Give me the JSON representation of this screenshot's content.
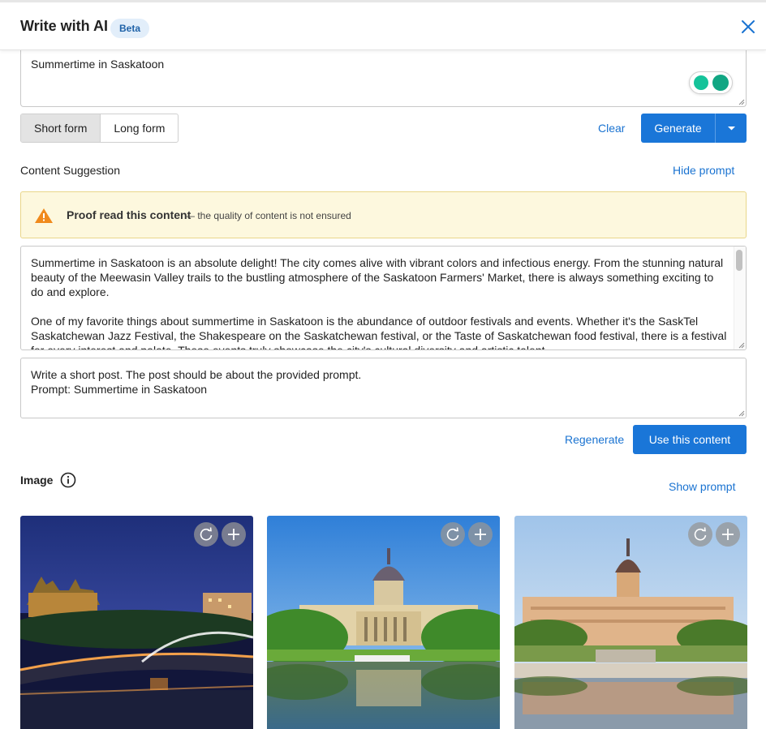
{
  "dialog": {
    "title": "Write with AI",
    "badge": "Beta"
  },
  "topic_input": {
    "value": "Summertime in Saskatoon"
  },
  "form_toggle": {
    "options": [
      "Short form",
      "Long form"
    ],
    "selected": "Short form"
  },
  "actions": {
    "clear": "Clear",
    "generate": "Generate"
  },
  "content": {
    "heading": "Content Suggestion",
    "hide_prompt": "Hide prompt",
    "alert_strong": "Proof read this content",
    "alert_rest": "— the quality of content is not ensured",
    "suggestion_text": "Summertime in Saskatoon is an absolute delight! The city comes alive with vibrant colors and infectious energy. From the stunning natural beauty of the Meewasin Valley trails to the bustling atmosphere of the Saskatoon Farmers' Market, there is always something exciting to do and explore.\n\nOne of my favorite things about summertime in Saskatoon is the abundance of outdoor festivals and events. Whether it's the SaskTel Saskatchewan Jazz Festival, the Shakespeare on the Saskatchewan festival, or the Taste of Saskatchewan food festival, there is a festival for every interest and palate. These events truly showcase the city's cultural diversity and artistic talent.",
    "prompt_text": "Write a short post. The post should be about the provided prompt.\nPrompt: Summertime in Saskatoon",
    "regenerate": "Regenerate",
    "use_content": "Use this content"
  },
  "image": {
    "heading": "Image",
    "show_prompt": "Show prompt",
    "thumbnails": [
      {
        "name": "night-bridge-skyline"
      },
      {
        "name": "legislative-building-blue-sky"
      },
      {
        "name": "legislative-building-sunset"
      }
    ]
  },
  "colors": {
    "accent": "#1a76d8",
    "alert_bg": "#fdf8de",
    "warning": "#f08a1c"
  },
  "icons": [
    "close-icon",
    "grammarly-icon",
    "chevron-down-icon",
    "warning-icon",
    "info-icon",
    "refresh-icon",
    "plus-icon"
  ]
}
